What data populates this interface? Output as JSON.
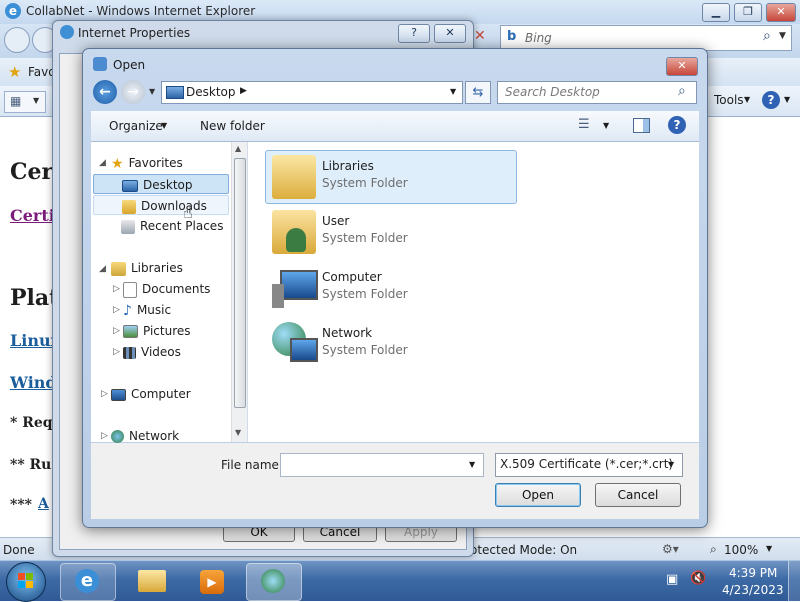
{
  "ie": {
    "window_title": "CollabNet - Windows Internet Explorer",
    "search_placeholder": "Bing",
    "fav_label": "Favo",
    "tools_label": "Tools",
    "status_text": "Done",
    "protected_mode": "otected Mode: On",
    "zoom": "100%",
    "page": {
      "heading1": "Cer",
      "link1": "Certi",
      "heading2": "Plat",
      "link_linux": "Linux",
      "link_windows": "Wind",
      "note1": "* Req",
      "note2": "** Ru",
      "note3": "***",
      "note3_link": "A"
    }
  },
  "internet_properties": {
    "title": "Internet Properties",
    "help_glyph": "?",
    "ok_label": "OK",
    "cancel_label": "Cancel",
    "apply_label": "Apply"
  },
  "open_dialog": {
    "title": "Open",
    "address": "Desktop",
    "search_placeholder": "Search Desktop",
    "organize_label": "Organize",
    "new_folder_label": "New folder",
    "nav": {
      "favorites": "Favorites",
      "desktop": "Desktop",
      "downloads": "Downloads",
      "recent_places": "Recent Places",
      "libraries": "Libraries",
      "documents": "Documents",
      "music": "Music",
      "pictures": "Pictures",
      "videos": "Videos",
      "computer": "Computer",
      "network": "Network"
    },
    "files": [
      {
        "name": "Libraries",
        "type": "System Folder",
        "icon": "libraries-icon"
      },
      {
        "name": "User",
        "type": "System Folder",
        "icon": "user-folder-icon"
      },
      {
        "name": "Computer",
        "type": "System Folder",
        "icon": "computer-icon"
      },
      {
        "name": "Network",
        "type": "System Folder",
        "icon": "network-icon"
      }
    ],
    "filename_label": "File name:",
    "filename_value": "",
    "filter_value": "X.509 Certificate (*.cer;*.crt)",
    "open_label": "Open",
    "cancel_label": "Cancel"
  },
  "taskbar": {
    "time": "4:39 PM",
    "date": "4/23/2023"
  },
  "colors": {
    "accent": "#1a5d9c",
    "selection": "#cde4f7",
    "close_red": "#c7463a"
  }
}
